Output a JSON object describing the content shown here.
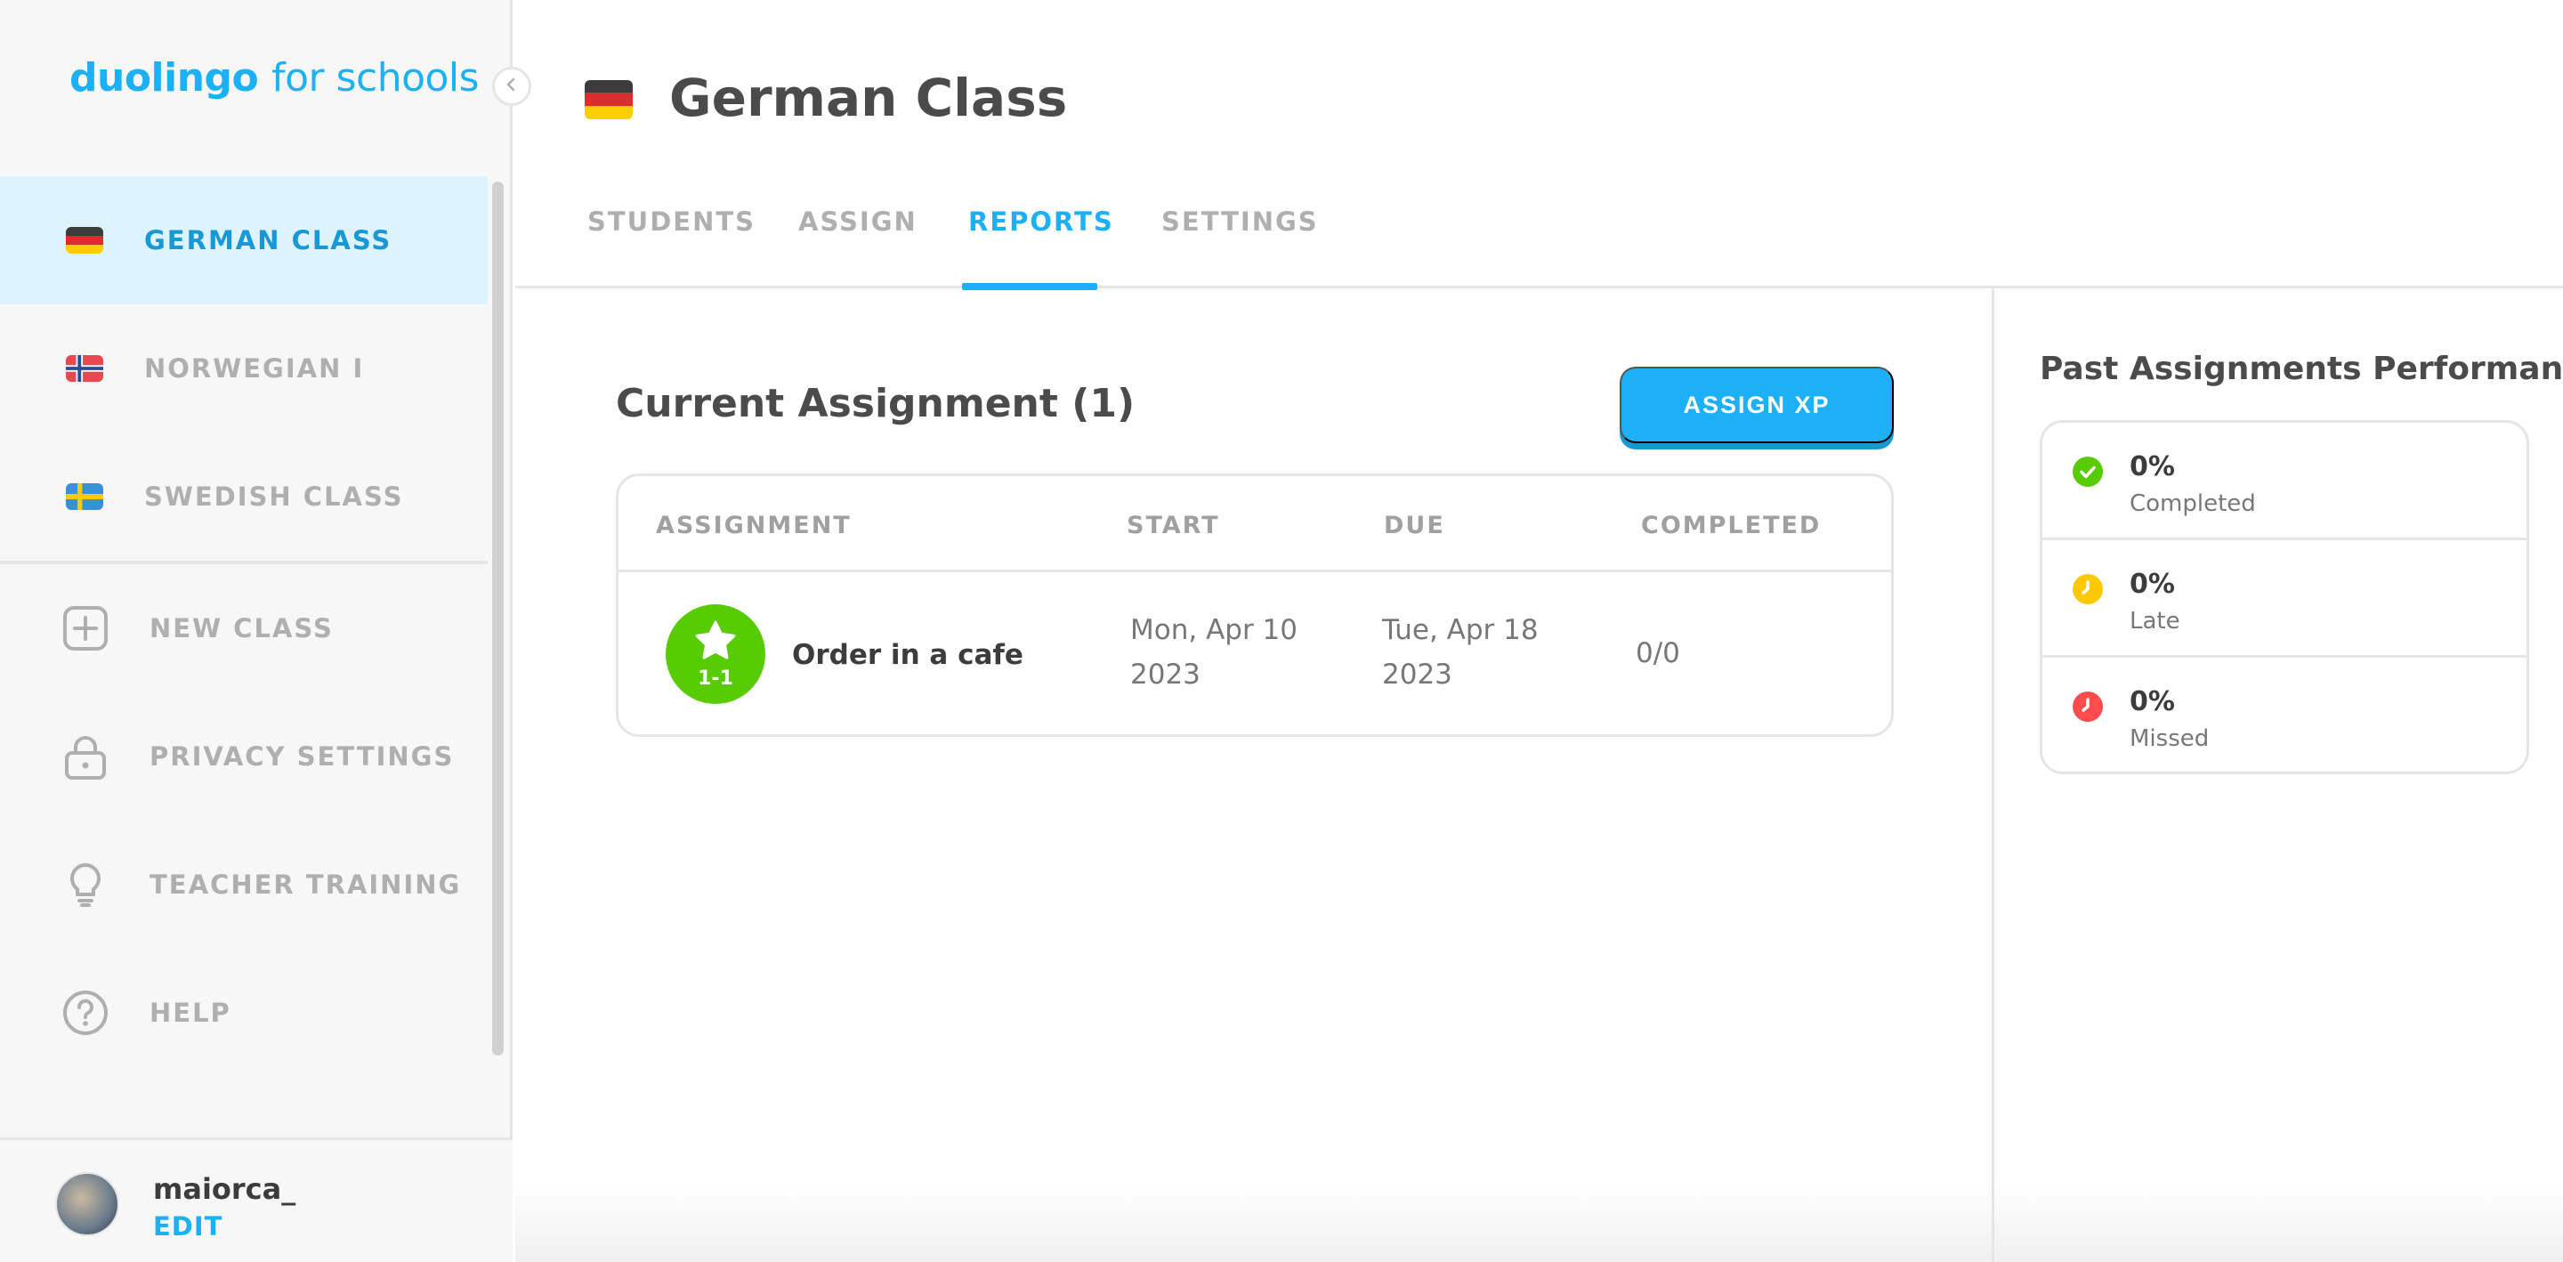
{
  "brand": {
    "name": "duolingo",
    "suffix": "for schools",
    "color": "#1cb0f6"
  },
  "sidebar": {
    "classes": [
      {
        "label": "GERMAN CLASS",
        "flag": "germany-flag",
        "active": true
      },
      {
        "label": "NORWEGIAN I",
        "flag": "norway-flag",
        "active": false
      },
      {
        "label": "SWEDISH CLASS",
        "flag": "sweden-flag",
        "active": false
      }
    ],
    "links": [
      {
        "label": "NEW CLASS",
        "icon": "plus-square-icon"
      },
      {
        "label": "PRIVACY SETTINGS",
        "icon": "lock-icon"
      },
      {
        "label": "TEACHER TRAINING",
        "icon": "lightbulb-icon"
      },
      {
        "label": "HELP",
        "icon": "question-circle-icon"
      }
    ],
    "user": {
      "username": "maiorca_",
      "edit_label": "EDIT"
    }
  },
  "header": {
    "title": "German Class",
    "flag": "germany-flag",
    "tabs": [
      {
        "label": "STUDENTS",
        "active": false
      },
      {
        "label": "ASSIGN",
        "active": false
      },
      {
        "label": "REPORTS",
        "active": true
      },
      {
        "label": "SETTINGS",
        "active": false
      }
    ]
  },
  "main": {
    "section_title": "Current Assignment (1)",
    "assign_button": "ASSIGN XP",
    "table": {
      "headers": [
        "ASSIGNMENT",
        "START",
        "DUE",
        "COMPLETED"
      ],
      "rows": [
        {
          "badge_icon": "star-icon",
          "badge_level": "1-1",
          "name": "Order in a cafe",
          "start_line1": "Mon, Apr 10",
          "start_line2": "2023",
          "due_line1": "Tue, Apr 18",
          "due_line2": "2023",
          "completed": "0/0"
        }
      ]
    }
  },
  "performance": {
    "title": "Past Assignments Performance",
    "items": [
      {
        "pct": "0%",
        "label": "Completed",
        "color": "#58cc02",
        "icon": "check-circle-icon"
      },
      {
        "pct": "0%",
        "label": "Late",
        "color": "#ffc800",
        "icon": "clock-icon"
      },
      {
        "pct": "0%",
        "label": "Missed",
        "color": "#ff4b4b",
        "icon": "clock-icon"
      }
    ]
  }
}
